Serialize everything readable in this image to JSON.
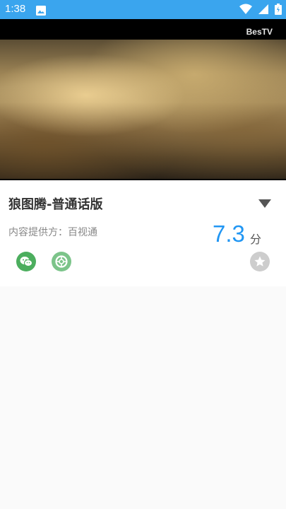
{
  "status_bar": {
    "time": "1:38",
    "icons": [
      "image-icon",
      "wifi-icon",
      "signal-icon",
      "battery-icon"
    ]
  },
  "video": {
    "logo_text": "BesTV"
  },
  "detail": {
    "title": "狼图腾-普通话版",
    "provider": "内容提供方：百视通",
    "rating": "7.3",
    "rating_unit": "分",
    "actions": [
      "wechat-share",
      "moments-share",
      "favorite"
    ]
  },
  "colors": {
    "status_bar": "#3aa5ee",
    "rating": "#2196f3",
    "wechat": "#4cae5e",
    "moments": "#7cc48a",
    "favorite": "#cdcdcd"
  }
}
